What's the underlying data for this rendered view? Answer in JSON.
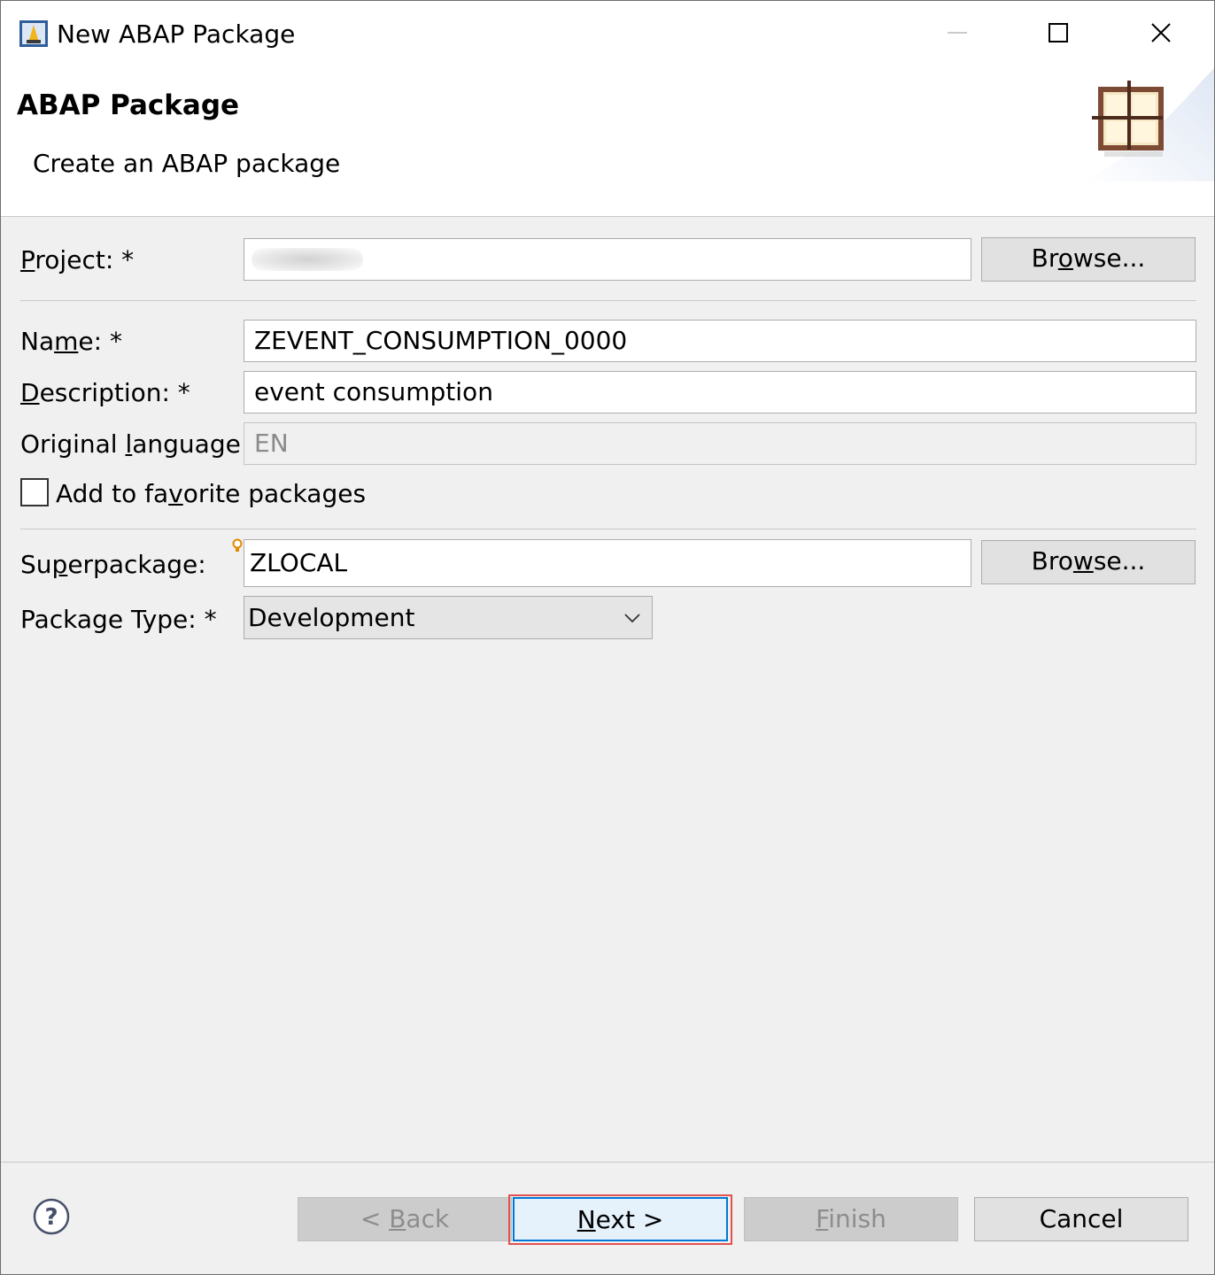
{
  "window": {
    "title": "New ABAP Package",
    "controls": [
      "minimize-icon",
      "maximize-icon",
      "close-icon"
    ]
  },
  "header": {
    "title": "ABAP Package",
    "description": "Create an ABAP package",
    "icon": "package-icon"
  },
  "form": {
    "project": {
      "label_pre": "",
      "label_mnemonic": "P",
      "label_post": "roject: *",
      "value": "",
      "browse_pre": "Br",
      "browse_mnemonic": "o",
      "browse_post": "wse..."
    },
    "name": {
      "label_pre": "Na",
      "label_mnemonic": "m",
      "label_post": "e: *",
      "value": "ZEVENT_CONSUMPTION_0000"
    },
    "description": {
      "label_pre": "",
      "label_mnemonic": "D",
      "label_post": "escription: *",
      "value": "event consumption"
    },
    "original_language": {
      "label_pre": "Original ",
      "label_mnemonic": "l",
      "label_post": "anguage:",
      "value": "EN"
    },
    "favorite": {
      "label_pre": "Add to fa",
      "label_mnemonic": "v",
      "label_post": "orite packages",
      "checked": false
    },
    "superpackage": {
      "label_pre": "Su",
      "label_mnemonic": "p",
      "label_post": "erpackage:",
      "value": "ZLOCAL",
      "browse_pre": "Bro",
      "browse_mnemonic": "w",
      "browse_post": "se..."
    },
    "package_type": {
      "label": "Package Type: *",
      "selected": "Development"
    }
  },
  "footer": {
    "back": {
      "prefix": "< ",
      "mnemonic": "B",
      "rest": "ack"
    },
    "next": {
      "mnemonic": "N",
      "rest": "ext >"
    },
    "finish": {
      "mnemonic": "F",
      "rest": "inish"
    },
    "cancel": "Cancel"
  },
  "colors": {
    "dialog_bg": "#f0f0f0",
    "highlight": "#e0524f",
    "default_button": "#0078d7"
  }
}
